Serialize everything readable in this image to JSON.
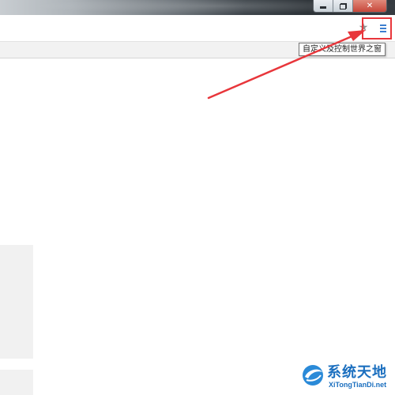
{
  "window": {
    "controls": [
      {
        "name": "minimize",
        "icon": "minimize-icon"
      },
      {
        "name": "restore",
        "icon": "restore-icon"
      },
      {
        "name": "close",
        "icon": "close-icon",
        "glyph": "✕"
      }
    ]
  },
  "toolbar": {
    "star_icon": "star-icon",
    "menu_icon": "hamburger-menu-icon"
  },
  "tooltip": {
    "text": "自定义及控制世界之窗"
  },
  "annotation": {
    "highlight_color": "#e8363b",
    "arrow_color": "#e8363b"
  },
  "watermark": {
    "title": "系统天地",
    "url": "XiTongTianDi.net",
    "color": "#1b6fbf"
  }
}
